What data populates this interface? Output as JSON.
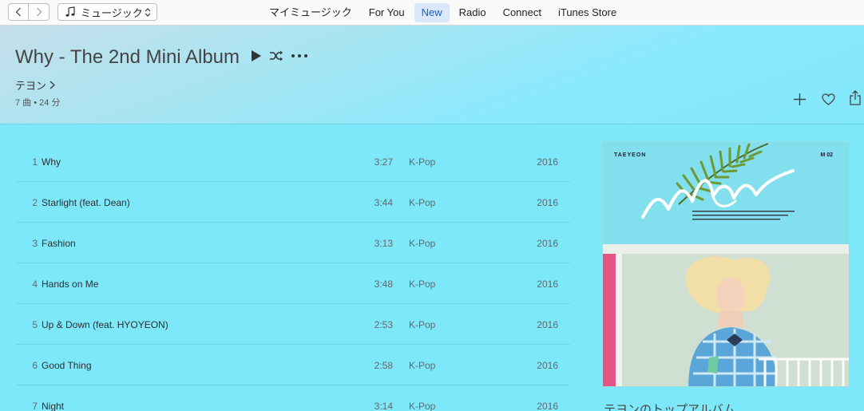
{
  "toolbar": {
    "source_label": "ミュージック",
    "tabs": [
      {
        "label": "マイミュージック",
        "active": false
      },
      {
        "label": "For You",
        "active": false
      },
      {
        "label": "New",
        "active": true
      },
      {
        "label": "Radio",
        "active": false
      },
      {
        "label": "Connect",
        "active": false
      },
      {
        "label": "iTunes Store",
        "active": false
      }
    ]
  },
  "album": {
    "title": "Why - The 2nd Mini Album",
    "artist": "テヨン",
    "meta": "7 曲 • 24 分"
  },
  "tracks": [
    {
      "num": "1",
      "name": "Why",
      "duration": "3:27",
      "genre": "K-Pop",
      "year": "2016"
    },
    {
      "num": "2",
      "name": "Starlight (feat. Dean)",
      "duration": "3:44",
      "genre": "K-Pop",
      "year": "2016"
    },
    {
      "num": "3",
      "name": "Fashion",
      "duration": "3:13",
      "genre": "K-Pop",
      "year": "2016"
    },
    {
      "num": "4",
      "name": "Hands on Me",
      "duration": "3:48",
      "genre": "K-Pop",
      "year": "2016"
    },
    {
      "num": "5",
      "name": "Up & Down (feat. HYOYEON)",
      "duration": "2:53",
      "genre": "K-Pop",
      "year": "2016"
    },
    {
      "num": "6",
      "name": "Good Thing",
      "duration": "2:58",
      "genre": "K-Pop",
      "year": "2016"
    },
    {
      "num": "7",
      "name": "Night",
      "duration": "3:14",
      "genre": "K-Pop",
      "year": "2016"
    }
  ],
  "artwork": {
    "brand": "TAEYEON",
    "edition": "M 02"
  },
  "sidebar": {
    "top_albums_heading": "テヨンのトップアルバム"
  },
  "colors": {
    "background": "#7ee8fb",
    "tab_active_bg": "#d9e9fb",
    "tab_active_text": "#1f5fbf"
  }
}
